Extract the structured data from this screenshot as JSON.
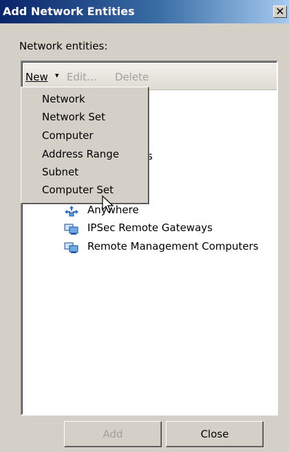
{
  "window": {
    "title": "Add Network Entities",
    "close_glyph": "✕"
  },
  "section_label": "Network entities:",
  "toolbar": {
    "new_label": "New",
    "new_arrow": "▾",
    "edit_label": "Edit...",
    "delete_label": "Delete"
  },
  "menu": {
    "items": [
      {
        "label": "Network"
      },
      {
        "label": "Network Set"
      },
      {
        "label": "Computer"
      },
      {
        "label": "Address Range"
      },
      {
        "label": "Subnet"
      },
      {
        "label": "Computer Set"
      }
    ]
  },
  "tree": {
    "partial_text": "s",
    "items": [
      {
        "label": "Anywhere",
        "icon": "anywhere-network-icon"
      },
      {
        "label": "IPSec Remote Gateways",
        "icon": "computer-set-icon"
      },
      {
        "label": "Remote Management Computers",
        "icon": "computer-set-icon"
      }
    ]
  },
  "buttons": {
    "add_label": "Add",
    "close_label": "Close"
  }
}
